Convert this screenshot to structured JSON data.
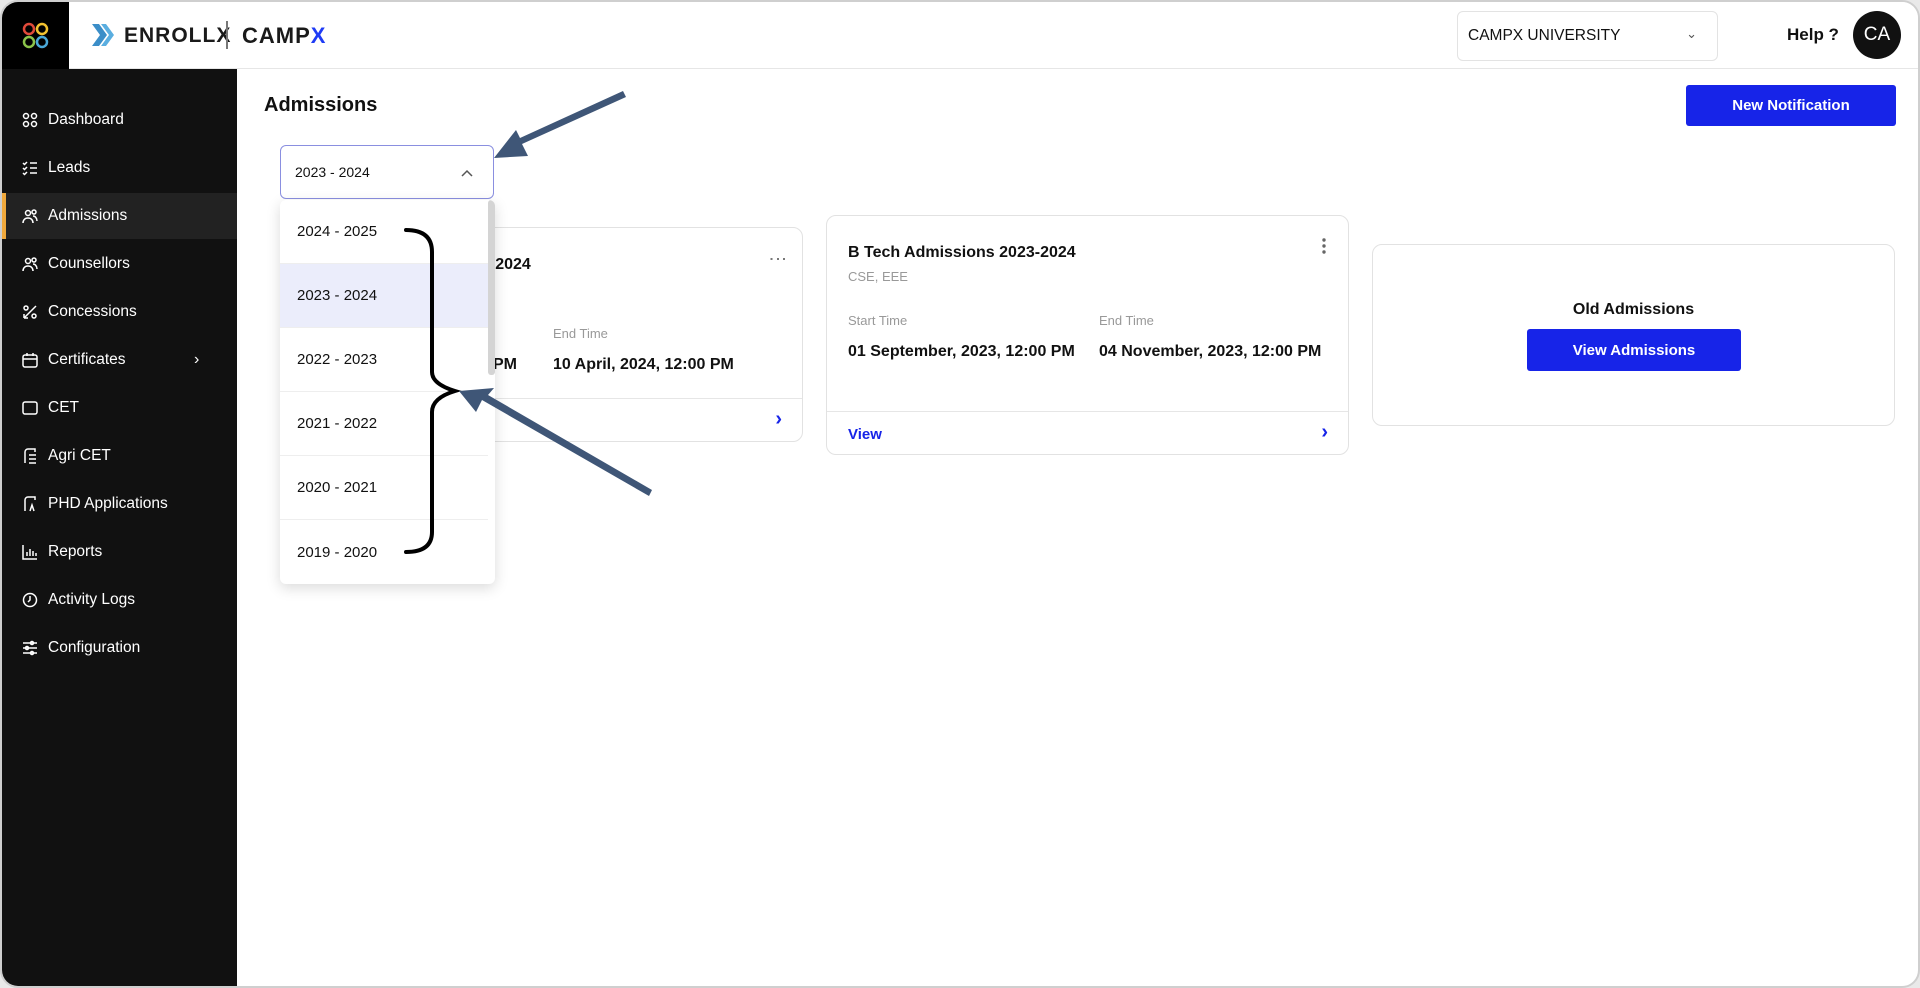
{
  "header": {
    "brand": "ENROLLX",
    "brand2_main": "CAMP",
    "brand2_accent": "X",
    "university": "CAMPX UNIVERSITY",
    "help": "Help ?",
    "avatar": "CA"
  },
  "sidebar": {
    "items": [
      {
        "label": "Dashboard",
        "icon": "grid-icon"
      },
      {
        "label": "Leads",
        "icon": "checklist-icon"
      },
      {
        "label": "Admissions",
        "icon": "users-icon",
        "active": true
      },
      {
        "label": "Counsellors",
        "icon": "users-icon"
      },
      {
        "label": "Concessions",
        "icon": "percent-icon"
      },
      {
        "label": "Certificates",
        "icon": "calendar-icon",
        "has_children": true
      },
      {
        "label": "CET",
        "icon": "square-icon"
      },
      {
        "label": "Agri CET",
        "icon": "document-icon"
      },
      {
        "label": "PHD Applications",
        "icon": "document-icon"
      },
      {
        "label": "Reports",
        "icon": "bar-chart-icon"
      },
      {
        "label": "Activity Logs",
        "icon": "clock-icon"
      },
      {
        "label": "Configuration",
        "icon": "sliders-icon"
      }
    ]
  },
  "main": {
    "title": "Admissions",
    "new_notification": "New Notification",
    "year_select": {
      "value": "2023 - 2024",
      "options": [
        "2024 - 2025",
        "2023 - 2024",
        "2022 - 2023",
        "2021 - 2022",
        "2020 - 2021",
        "2019 - 2020"
      ]
    },
    "card1": {
      "title_fragment": "3-2024",
      "start_fragment": "PM",
      "end_label": "End Time",
      "end_value": "10 April, 2024, 12:00 PM"
    },
    "card2": {
      "title": "B Tech Admissions 2023-2024",
      "subtitle": "CSE, EEE",
      "start_label": "Start Time",
      "start_value": "01 September, 2023, 12:00 PM",
      "end_label": "End Time",
      "end_value": "04 November, 2023, 12:00 PM",
      "view": "View"
    },
    "old": {
      "title": "Old Admissions",
      "button": "View Admissions"
    }
  },
  "colors": {
    "accent": "#1724e8",
    "sidebar": "#111111",
    "active_marker": "#f0a93c",
    "annotation": "#3f5677"
  }
}
